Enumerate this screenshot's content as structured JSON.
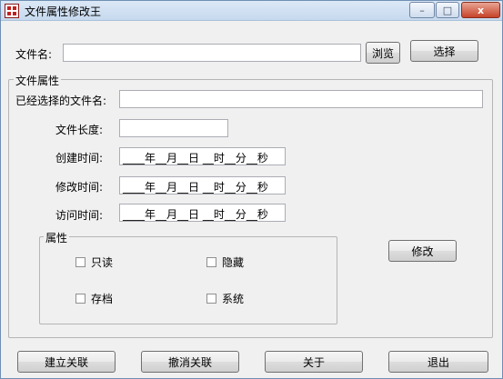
{
  "window": {
    "title": "文件属性修改王",
    "controls": {
      "minimize": "–",
      "maximize": "□",
      "close": "x"
    }
  },
  "file": {
    "label": "文件名:",
    "value": "",
    "browse_label": "浏览",
    "select_label": "选择"
  },
  "attributes_group": {
    "title": "文件属性",
    "selected_file_label": "已经选择的文件名:",
    "selected_file_value": "",
    "size_label": "文件长度:",
    "size_value": "",
    "created_label": "创建时间:",
    "created_value": "____年__月__日 __时__分__秒",
    "modified_label": "修改时间:",
    "modified_value": "____年__月__日 __时__分__秒",
    "accessed_label": "访问时间:",
    "accessed_value": "____年__月__日 __时__分__秒"
  },
  "flags_group": {
    "title": "属性",
    "readonly_label": "只读",
    "readonly_checked": false,
    "hidden_label": "隐藏",
    "hidden_checked": false,
    "archive_label": "存档",
    "archive_checked": false,
    "system_label": "系统",
    "system_checked": false
  },
  "modify_label": "修改",
  "footer": {
    "associate_label": "建立关联",
    "unassociate_label": "撤消关联",
    "about_label": "关于",
    "exit_label": "退出"
  }
}
